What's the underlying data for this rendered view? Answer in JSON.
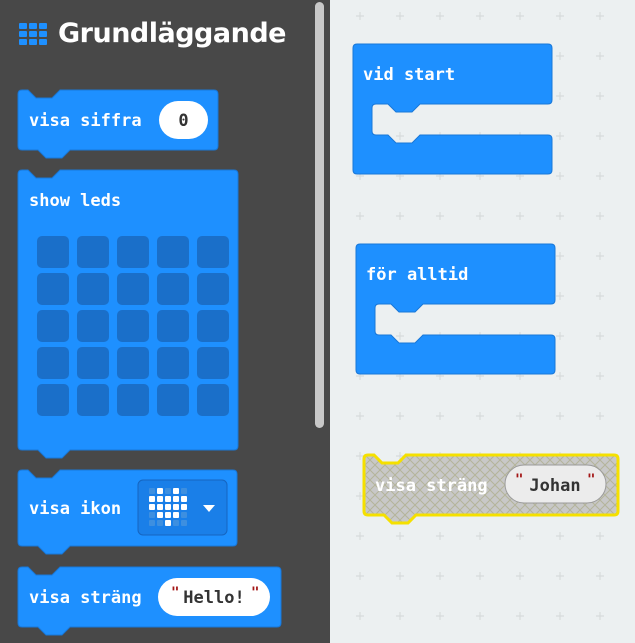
{
  "category": {
    "title": "Grundläggande",
    "icon": "grid-icon",
    "color": "#1e90ff"
  },
  "flyout_blocks": {
    "show_number": {
      "label": "visa siffra",
      "value": "0"
    },
    "show_leds": {
      "label": "show leds",
      "rows": 5,
      "cols": 5
    },
    "show_icon": {
      "label": "visa ikon",
      "icon": "heart-icon"
    },
    "show_string": {
      "label": "visa sträng",
      "value": "Hello!"
    }
  },
  "workspace": {
    "on_start": {
      "label": "vid start"
    },
    "forever": {
      "label": "för alltid"
    },
    "show_string": {
      "label": "visa sträng",
      "value": "Johan",
      "state": "disabled-highlighted"
    }
  },
  "colors": {
    "block": "#1e90ff",
    "block_border": "#1877d8",
    "led_off": "#1a6fc9",
    "flyout_bg": "#484848",
    "workspace_bg": "#ecf0f1",
    "highlight": "#f5e000",
    "disabled_fill": "#c8c8c8",
    "quote": "#a31515"
  }
}
